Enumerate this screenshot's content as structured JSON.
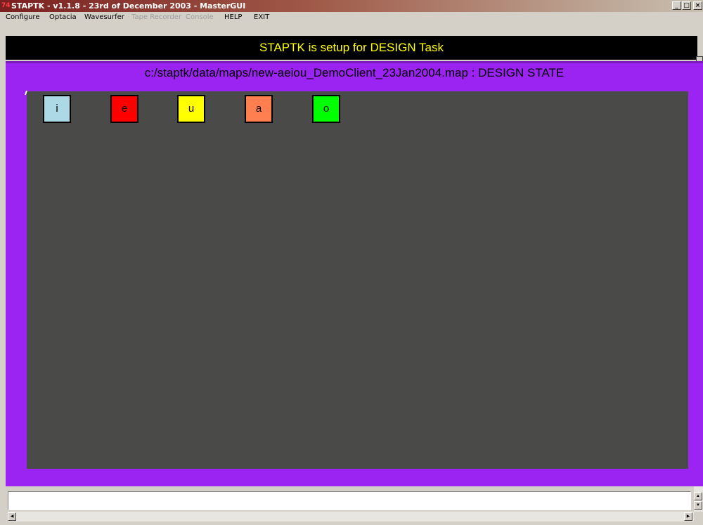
{
  "window": {
    "title": "STAPTK - v1.1.8 - 23rd of December 2003 - MasterGUI",
    "icon": "74",
    "controls": {
      "minimize": "_",
      "maximize": "□",
      "close": "×"
    }
  },
  "menu": {
    "items": [
      {
        "label": "Configure",
        "enabled": true
      },
      {
        "label": "Optacia",
        "enabled": true
      },
      {
        "label": "Wavesurfer",
        "enabled": true
      },
      {
        "label": "Tape Recorder",
        "enabled": false
      },
      {
        "label": "Console",
        "enabled": false
      },
      {
        "label": "HELP",
        "enabled": true
      },
      {
        "label": "EXIT",
        "enabled": true
      }
    ]
  },
  "banner": {
    "text": "STAPTK is setup for DESIGN Task",
    "bg": "#000000",
    "color": "#ffff00"
  },
  "design": {
    "title": "c:/staptk/data/maps/new-aeiou_DemoClient_23Jan2004.map : DESIGN STATE",
    "frame_color": "#9c24f2",
    "canvas_color": "#4a4b48",
    "vowels": [
      {
        "label": "i",
        "color": "#add8e6"
      },
      {
        "label": "e",
        "color": "#ff0000"
      },
      {
        "label": "u",
        "color": "#ffff00"
      },
      {
        "label": "a",
        "color": "#ff7f50"
      },
      {
        "label": "o",
        "color": "#00ff00"
      }
    ]
  },
  "console": {
    "input_value": ""
  }
}
